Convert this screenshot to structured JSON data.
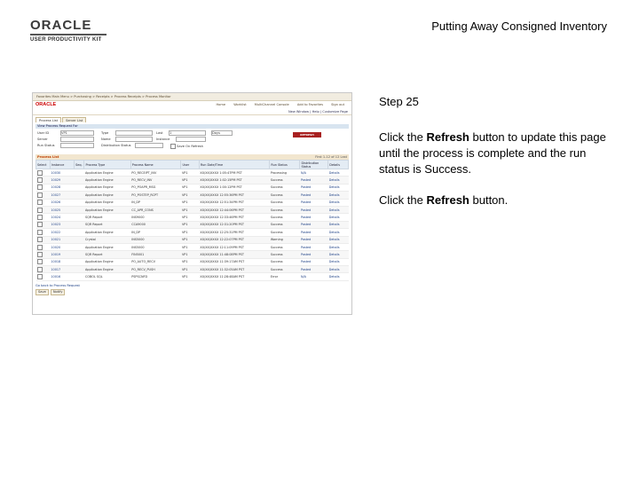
{
  "header": {
    "logo_text": "ORACLE",
    "logo_sub": "USER PRODUCTIVITY KIT",
    "title": "Putting Away Consigned Inventory"
  },
  "instructions": {
    "step": "Step 25",
    "p1_before": "Click the ",
    "p1_bold": "Refresh",
    "p1_after": " button to update this page until the process is complete and the run status is Success.",
    "p2_before": "Click the ",
    "p2_bold": "Refresh",
    "p2_after": " button."
  },
  "screenshot": {
    "brand": "ORACLE",
    "top_menu": "Favorites   Main Menu   >  Purchasing  >  Receipts  >  Process Receipts  >  Process Monitor",
    "sub_nav": [
      "Home",
      "Worklist",
      "MultiChannel Console",
      "Add to Favorites",
      "Sign out"
    ],
    "page_links": "New Window | Help | Customize Page",
    "tabs": [
      "Process List",
      "Server List"
    ],
    "section_title": "View Process Request For",
    "criteria": {
      "user_id_label": "User ID",
      "user_id_value": "VP1",
      "type_label": "Type",
      "last_label": "Last",
      "last_value": "1",
      "days_value": "Days",
      "server_label": "Server",
      "name_label": "Name",
      "instance_label": "Instance",
      "run_status_label": "Run Status",
      "dist_status_label": "Distribution Status",
      "save_label": "Save On Refresh",
      "refresh_button": "REFRESH"
    },
    "list_title": "Process List",
    "list_nav": "First  1-12 of 12  Last",
    "columns": [
      "Select",
      "Instance",
      "Seq.",
      "Process Type",
      "Process Name",
      "User",
      "Run Date/Time",
      "Run Status",
      "Distribution Status",
      "Details"
    ],
    "rows": [
      [
        "10030",
        "Application Engine",
        "PO_RECEIPT_INV",
        "VP1",
        "XX/XX/XXXX 1:05:47PM PST",
        "Processing",
        "N/A",
        "Details"
      ],
      [
        "10029",
        "Application Engine",
        "PO_RECV_INV",
        "VP1",
        "XX/XX/XXXX 1:02:15PM PST",
        "Success",
        "Posted",
        "Details"
      ],
      [
        "10028",
        "Application Engine",
        "PO_POAPR_MSG",
        "VP1",
        "XX/XX/XXXX 1:00:12PM PST",
        "Success",
        "Posted",
        "Details"
      ],
      [
        "10027",
        "Application Engine",
        "PO_POSTEP_RCPT",
        "VP1",
        "XX/XX/XXXX 12:55:36PM PST",
        "Success",
        "Posted",
        "Details"
      ],
      [
        "10026",
        "Application Engine",
        "IN_DP",
        "VP1",
        "XX/XX/XXXX 12:51:34PM PST",
        "Success",
        "Posted",
        "Details"
      ],
      [
        "10025",
        "Application Engine",
        "CC_APR_CONS",
        "VP1",
        "XX/XX/XXXX 12:44:06PM PST",
        "Success",
        "Posted",
        "Details"
      ],
      [
        "10024",
        "SQR Report",
        "INS9000",
        "VP1",
        "XX/XX/XXXX 12:33:46PM PST",
        "Success",
        "Posted",
        "Details"
      ],
      [
        "10023",
        "SQR Report",
        "CCA9000",
        "VP1",
        "XX/XX/XXXX 12:31:20PM PST",
        "Success",
        "Posted",
        "Details"
      ],
      [
        "10022",
        "Application Engine",
        "IN_DP",
        "VP1",
        "XX/XX/XXXX 12:25:31PM PST",
        "Success",
        "Posted",
        "Details"
      ],
      [
        "10021",
        "Crystal",
        "INS5000",
        "VP1",
        "XX/XX/XXXX 12:22:07PM PST",
        "Warning",
        "Posted",
        "Details"
      ],
      [
        "10020",
        "Application Engine",
        "INS5000",
        "VP1",
        "XX/XX/XXXX 12:11:09PM PST",
        "Success",
        "Posted",
        "Details"
      ],
      [
        "10019",
        "SQR Report",
        "FIN5001",
        "VP1",
        "XX/XX/XXXX 11:48:08PM PST",
        "Success",
        "Posted",
        "Details"
      ],
      [
        "10018",
        "Application Engine",
        "PO_AUTO_RECV",
        "VP1",
        "XX/XX/XXXX 11:39:17AM PST",
        "Success",
        "Posted",
        "Details"
      ],
      [
        "10017",
        "Application Engine",
        "PO_RECV_PUSH",
        "VP1",
        "XX/XX/XXXX 11:32:05AM PST",
        "Success",
        "Posted",
        "Details"
      ],
      [
        "10016",
        "COBOL SQL",
        "PSPSCNFD",
        "VP1",
        "XX/XX/XXXX 11:28:48AM PST",
        "Error",
        "N/A",
        "Details"
      ]
    ],
    "go_back": "Go back to Process Request",
    "buttons": [
      "Save",
      "Notify"
    ]
  }
}
